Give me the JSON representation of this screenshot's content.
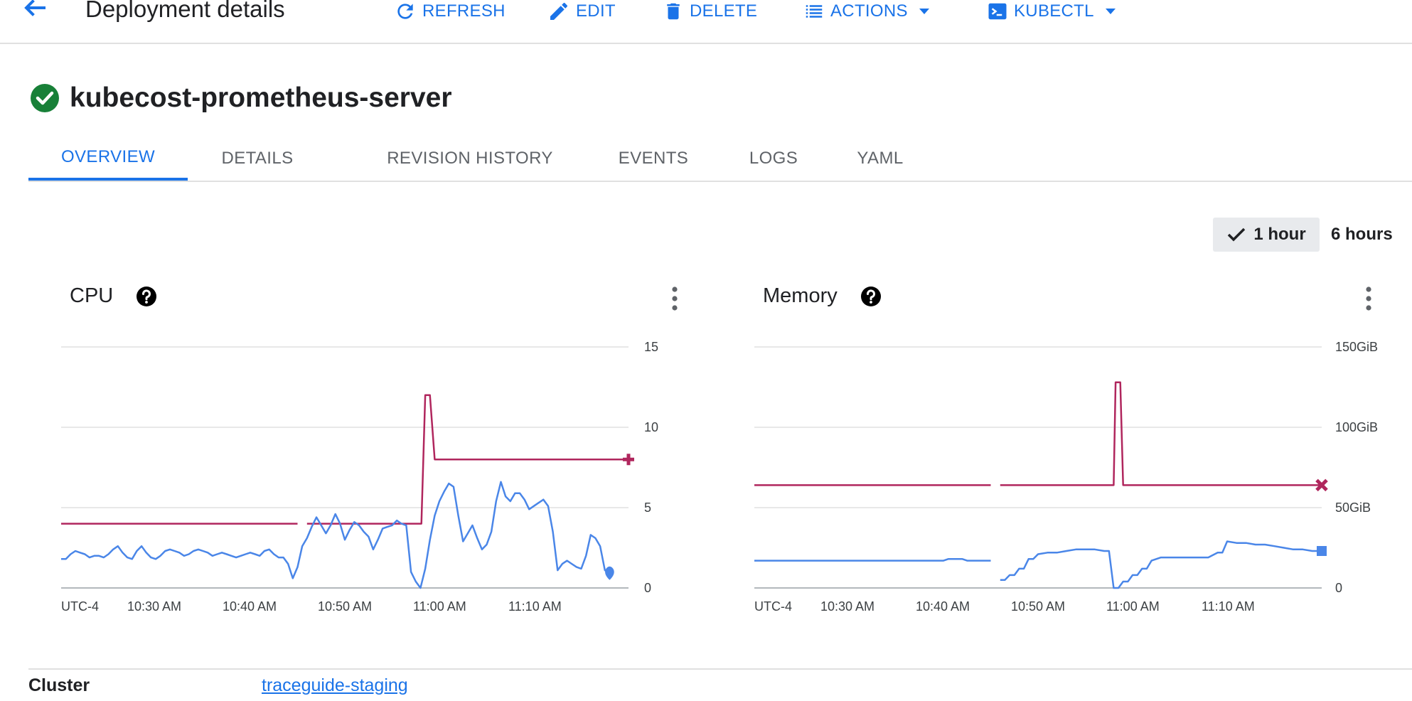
{
  "header": {
    "title": "Deployment details",
    "actions": [
      {
        "label": "REFRESH",
        "icon": "refresh-icon"
      },
      {
        "label": "EDIT",
        "icon": "edit-pencil-icon"
      },
      {
        "label": "DELETE",
        "icon": "trash-icon"
      },
      {
        "label": "ACTIONS",
        "icon": "list-icon",
        "dropdown": true
      },
      {
        "label": "KUBECTL",
        "icon": "terminal-icon",
        "dropdown": true
      }
    ]
  },
  "resource": {
    "name": "kubecost-prometheus-server",
    "status_icon": "check-circle-icon",
    "status_color": "#188038"
  },
  "tabs": [
    "OVERVIEW",
    "DETAILS",
    "REVISION HISTORY",
    "EVENTS",
    "LOGS",
    "YAML"
  ],
  "active_tab": "OVERVIEW",
  "time_range": {
    "options": [
      "1 hour",
      "6 hours"
    ],
    "selected": "1 hour"
  },
  "colors": {
    "accent": "#1a73e8",
    "limit_line": "#b0265d",
    "usage_line": "#4a86e8",
    "gridline": "#e0e0e0"
  },
  "chart_data": [
    {
      "type": "line",
      "title": "CPU",
      "x_labels": [
        "UTC-4",
        "10:30 AM",
        "10:40 AM",
        "10:50 AM",
        "11:00 AM",
        "11:10 AM"
      ],
      "y_ticks": [
        "15",
        "10",
        "5",
        "0"
      ],
      "ylim": [
        0,
        15
      ],
      "x_range_minutes": [
        0,
        60
      ],
      "grid": true,
      "series": [
        {
          "color": "#b0265d",
          "marker": "plus",
          "points": [
            [
              0,
              4
            ],
            [
              25,
              4
            ],
            null,
            [
              26,
              4
            ],
            [
              38,
              4
            ],
            [
              38.1,
              4
            ],
            [
              38.5,
              12
            ],
            [
              39,
              12
            ],
            [
              39.5,
              8
            ],
            [
              60,
              8
            ]
          ]
        },
        {
          "color": "#4a86e8",
          "marker": "drop",
          "points": [
            [
              0,
              1.8
            ],
            [
              0.5,
              1.8
            ],
            [
              1,
              2.1
            ],
            [
              1.5,
              2.3
            ],
            [
              2,
              2.2
            ],
            [
              2.5,
              2.1
            ],
            [
              3,
              1.9
            ],
            [
              3.5,
              2.0
            ],
            [
              4,
              2.0
            ],
            [
              4.5,
              1.9
            ],
            [
              5,
              2.1
            ],
            [
              5.5,
              2.4
            ],
            [
              6,
              2.6
            ],
            [
              6.5,
              2.2
            ],
            [
              7,
              1.9
            ],
            [
              7.5,
              1.8
            ],
            [
              8,
              2.3
            ],
            [
              8.5,
              2.6
            ],
            [
              9,
              2.2
            ],
            [
              9.5,
              1.9
            ],
            [
              10,
              1.8
            ],
            [
              10.5,
              2.0
            ],
            [
              11,
              2.3
            ],
            [
              11.5,
              2.4
            ],
            [
              12,
              2.3
            ],
            [
              12.5,
              2.2
            ],
            [
              13,
              2.0
            ],
            [
              13.5,
              2.1
            ],
            [
              14,
              2.3
            ],
            [
              14.5,
              2.4
            ],
            [
              15,
              2.3
            ],
            [
              15.5,
              2.2
            ],
            [
              16,
              2.0
            ],
            [
              16.5,
              2.1
            ],
            [
              17,
              2.2
            ],
            [
              17.5,
              2.1
            ],
            [
              18,
              2.0
            ],
            [
              18.5,
              1.9
            ],
            [
              19,
              2.0
            ],
            [
              19.5,
              2.1
            ],
            [
              20,
              2.2
            ],
            [
              20.5,
              2.1
            ],
            [
              21,
              2.0
            ],
            [
              21.5,
              2.3
            ],
            [
              22,
              2.4
            ],
            [
              22.5,
              2.1
            ],
            [
              23,
              1.9
            ],
            [
              23.5,
              1.9
            ],
            [
              24,
              1.5
            ],
            [
              24.5,
              0.6
            ],
            [
              25,
              1.3
            ],
            [
              25.5,
              2.6
            ],
            [
              26,
              3.1
            ],
            [
              26.5,
              3.8
            ],
            [
              27,
              4.4
            ],
            [
              27.5,
              3.9
            ],
            [
              28,
              3.4
            ],
            [
              28.5,
              3.9
            ],
            [
              29,
              4.6
            ],
            [
              29.5,
              4.0
            ],
            [
              30,
              3.0
            ],
            [
              30.5,
              3.6
            ],
            [
              31,
              4.1
            ],
            [
              31.5,
              3.9
            ],
            [
              32,
              3.5
            ],
            [
              32.5,
              3.2
            ],
            [
              33,
              2.4
            ],
            [
              33.5,
              3.0
            ],
            [
              34,
              3.7
            ],
            [
              34.5,
              3.8
            ],
            [
              35,
              3.9
            ],
            [
              35.5,
              4.2
            ],
            [
              36,
              4.0
            ],
            [
              36.5,
              3.9
            ],
            [
              37,
              1.0
            ],
            [
              37.5,
              0.4
            ],
            [
              38,
              0.0
            ],
            [
              38.5,
              1.2
            ],
            [
              39,
              3.0
            ],
            [
              39.5,
              4.5
            ],
            [
              40,
              5.4
            ],
            [
              40.5,
              6.0
            ],
            [
              41,
              6.5
            ],
            [
              41.5,
              6.3
            ],
            [
              42,
              4.5
            ],
            [
              42.5,
              2.9
            ],
            [
              43,
              3.4
            ],
            [
              43.5,
              3.9
            ],
            [
              44,
              3.1
            ],
            [
              44.5,
              2.4
            ],
            [
              45,
              2.7
            ],
            [
              45.5,
              3.5
            ],
            [
              46,
              5.4
            ],
            [
              46.5,
              6.6
            ],
            [
              47,
              5.7
            ],
            [
              47.5,
              5.4
            ],
            [
              48,
              5.9
            ],
            [
              48.5,
              5.9
            ],
            [
              49,
              5.5
            ],
            [
              49.5,
              4.9
            ],
            [
              50,
              5.1
            ],
            [
              50.5,
              5.3
            ],
            [
              51,
              5.5
            ],
            [
              51.5,
              5.1
            ],
            [
              52,
              3.5
            ],
            [
              52.5,
              1.1
            ],
            [
              53,
              1.5
            ],
            [
              53.5,
              1.7
            ],
            [
              54,
              1.5
            ],
            [
              54.5,
              1.3
            ],
            [
              55,
              1.2
            ],
            [
              55.5,
              2.0
            ],
            [
              56,
              3.3
            ],
            [
              56.5,
              3.1
            ],
            [
              57,
              2.6
            ],
            [
              57.5,
              1.1
            ],
            [
              58,
              0.9
            ]
          ]
        }
      ]
    },
    {
      "type": "line",
      "title": "Memory",
      "x_labels": [
        "UTC-4",
        "10:30 AM",
        "10:40 AM",
        "10:50 AM",
        "11:00 AM",
        "11:10 AM"
      ],
      "y_ticks": [
        "150GiB",
        "100GiB",
        "50GiB",
        "0"
      ],
      "ylim": [
        0,
        150
      ],
      "x_range_minutes": [
        0,
        60
      ],
      "grid": true,
      "series": [
        {
          "color": "#b0265d",
          "marker": "x",
          "points": [
            [
              0,
              64
            ],
            [
              25,
              64
            ],
            null,
            [
              26,
              64
            ],
            [
              38,
              64
            ],
            [
              38.2,
              128
            ],
            [
              38.7,
              128
            ],
            [
              39,
              64
            ],
            [
              60,
              64
            ]
          ]
        },
        {
          "color": "#4a86e8",
          "marker": "square",
          "points": [
            [
              0,
              17
            ],
            [
              20,
              17
            ],
            [
              20.5,
              18
            ],
            [
              22,
              18
            ],
            [
              22.5,
              17
            ],
            [
              25,
              17
            ],
            null,
            [
              26,
              5
            ],
            [
              26.5,
              5
            ],
            [
              27,
              8
            ],
            [
              27.5,
              8
            ],
            [
              28,
              12
            ],
            [
              28.5,
              12
            ],
            [
              29,
              18
            ],
            [
              29.5,
              18
            ],
            [
              30,
              21
            ],
            [
              31,
              22
            ],
            [
              32,
              22
            ],
            [
              33,
              23
            ],
            [
              34,
              24
            ],
            [
              35,
              24
            ],
            [
              36,
              24
            ],
            [
              37,
              23
            ],
            [
              37.5,
              23
            ],
            [
              38,
              0
            ],
            [
              38.5,
              0
            ],
            [
              39,
              4
            ],
            [
              39.5,
              4
            ],
            [
              40,
              8
            ],
            [
              40.5,
              8
            ],
            [
              41,
              12
            ],
            [
              41.5,
              12
            ],
            [
              42,
              17
            ],
            [
              43,
              19
            ],
            [
              45,
              19
            ],
            [
              47,
              19
            ],
            [
              48,
              19
            ],
            [
              49,
              22
            ],
            [
              49.5,
              22
            ],
            [
              50,
              29
            ],
            [
              51,
              28
            ],
            [
              52,
              28
            ],
            [
              53,
              27
            ],
            [
              54,
              27
            ],
            [
              55,
              26
            ],
            [
              56,
              25
            ],
            [
              57,
              24
            ],
            [
              58,
              24
            ],
            [
              59,
              23
            ],
            [
              60,
              23
            ]
          ]
        }
      ]
    }
  ],
  "info": {
    "label": "Cluster",
    "value": "traceguide-staging"
  }
}
